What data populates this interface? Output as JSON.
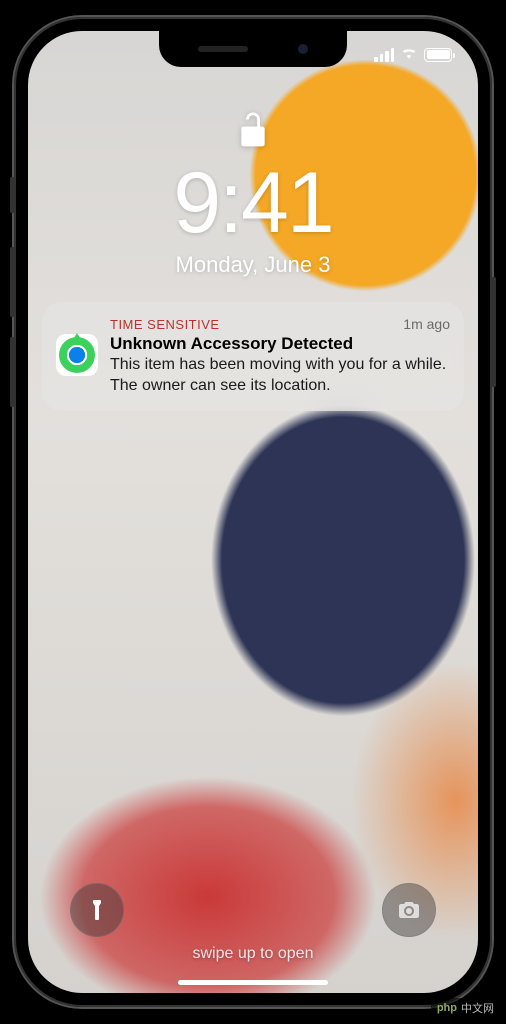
{
  "status": {
    "signal_bars": 4,
    "wifi": true,
    "battery_pct": 100
  },
  "lockscreen": {
    "locked": false,
    "time": "9:41",
    "date": "Monday, June 3",
    "swipe_hint": "swipe up to open"
  },
  "notification": {
    "label": "TIME SENSITIVE",
    "timestamp": "1m ago",
    "title": "Unknown Accessory Detected",
    "message": "This item has been moving with you for a while. The owner can see its location.",
    "app_icon": "find-my"
  },
  "watermark": {
    "text": "中文网",
    "prefix": "php"
  }
}
